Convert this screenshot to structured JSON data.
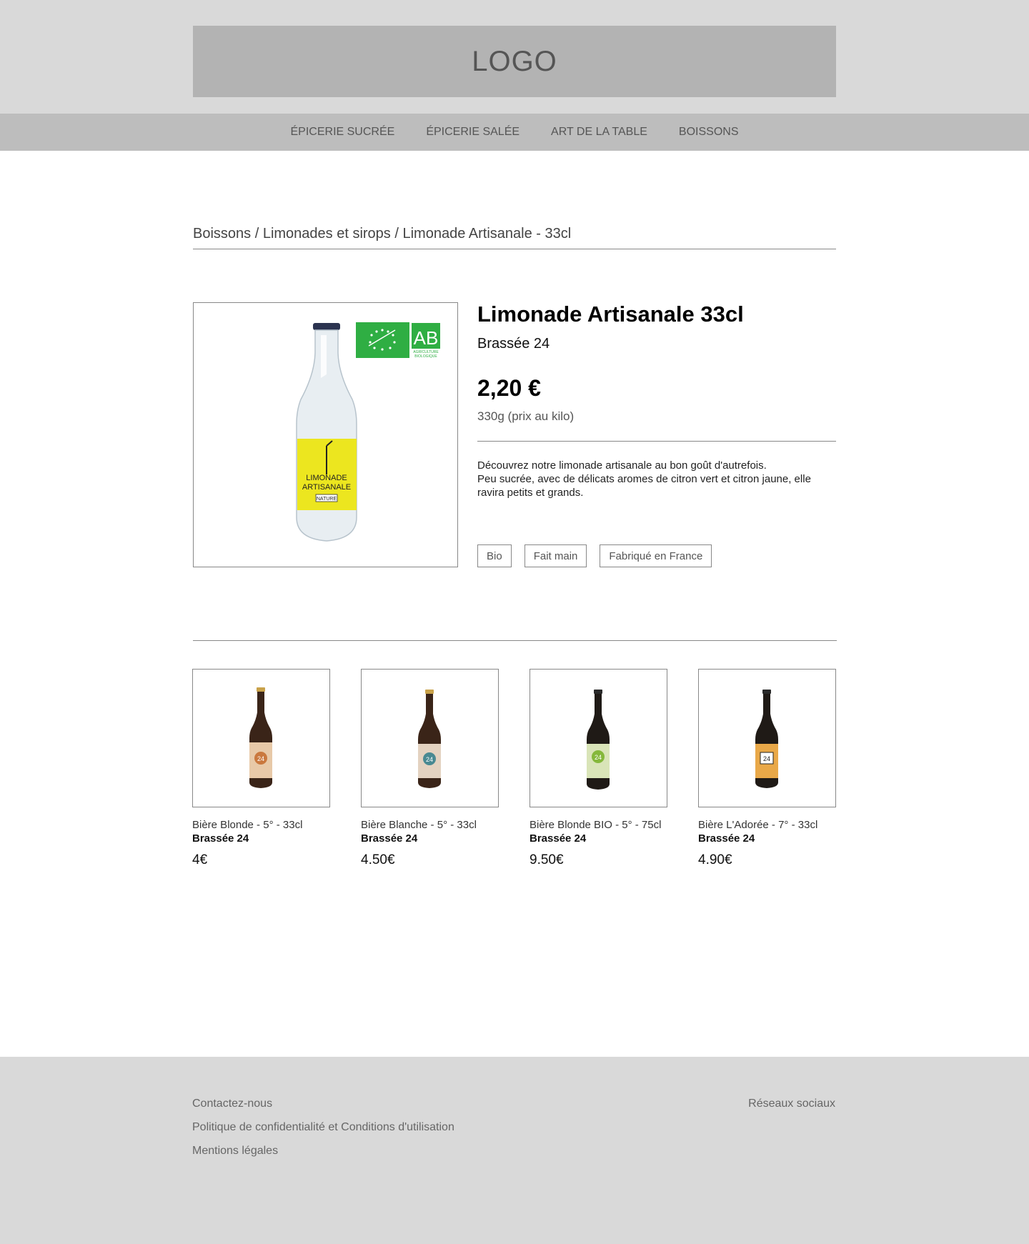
{
  "header": {
    "logo_text": "LOGO"
  },
  "nav": {
    "items": [
      {
        "label": "ÉPICERIE SUCRÉE"
      },
      {
        "label": "ÉPICERIE SALÉE"
      },
      {
        "label": "ART DE LA TABLE"
      },
      {
        "label": "BOISSONS"
      }
    ]
  },
  "breadcrumb": {
    "text": "Boissons / Limonades et sirops / Limonade Artisanale - 33cl"
  },
  "product": {
    "title": "Limonade Artisanale 33cl",
    "brand": "Brassée 24",
    "price": "2,20 €",
    "unit_price": "330g (prix au kilo)",
    "description_line1": "Découvrez notre limonade artisanale au bon goût d'autrefois.",
    "description_line2": "Peu sucrée, avec de délicats aromes de citron vert et citron jaune, elle ravira petits et grands.",
    "bottle_label_line1": "LIMONADE",
    "bottle_label_line2": "ARTISANALE",
    "bottle_label_tag": "NATURE",
    "organic_badge": {
      "letters": "AB",
      "caption_line1": "AGRICULTURE",
      "caption_line2": "BIOLOGIQUE",
      "color": "#2fae43"
    },
    "tags": [
      {
        "label": "Bio"
      },
      {
        "label": "Fait main"
      },
      {
        "label": "Fabriqué en France"
      }
    ],
    "label_color": "#ece61f"
  },
  "related": [
    {
      "name": "Bière Blonde  - 5° - 33cl",
      "brand": "Brassée 24",
      "price": "4€",
      "label_color": "#e8c9a8",
      "badge": "24"
    },
    {
      "name": "Bière Blanche  - 5° - 33cl",
      "brand": "Brassée 24",
      "price": "4.50€",
      "label_color": "#e3d2c0",
      "badge": "24"
    },
    {
      "name": "Bière Blonde BIO  - 5° - 75cl",
      "brand": "Brassée 24",
      "price": "9.50€",
      "label_color": "#d9e4b8",
      "badge": "24"
    },
    {
      "name": "Bière L'Adorée  - 7° - 33cl",
      "brand": "Brassée 24",
      "price": "4.90€",
      "label_color": "#e9a848",
      "badge": "24"
    }
  ],
  "footer": {
    "contact": "Contactez-nous",
    "privacy": "Politique de confidentialité et Conditions d'utilisation",
    "legal": "Mentions légales",
    "social": "Réseaux sociaux"
  }
}
